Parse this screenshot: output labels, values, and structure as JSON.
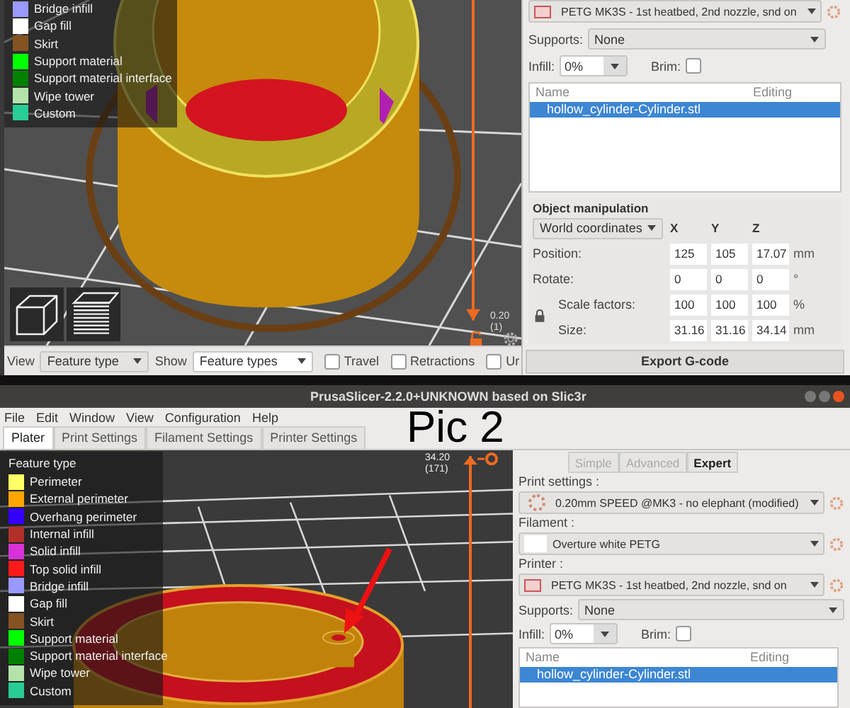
{
  "top": {
    "legend": [
      {
        "label": "Bridge infill",
        "color": "#9999ff"
      },
      {
        "label": "Gap fill",
        "color": "#ffffff"
      },
      {
        "label": "Skirt",
        "color": "#845321"
      },
      {
        "label": "Support material",
        "color": "#00ff00"
      },
      {
        "label": "Support material interface",
        "color": "#008000"
      },
      {
        "label": "Wipe tower",
        "color": "#b3e3ab"
      },
      {
        "label": "Custom",
        "color": "#28cc94"
      }
    ],
    "view": {
      "label": "View",
      "value": "Feature type"
    },
    "show": {
      "label": "Show",
      "value": "Feature types"
    },
    "options": [
      {
        "label": "Travel",
        "checked": false
      },
      {
        "label": "Retractions",
        "checked": false
      },
      {
        "label": "Ur",
        "checked": false
      }
    ],
    "slider": {
      "value": "0.20",
      "layer": "(1)"
    },
    "printer_value": "PETG MK3S - 1st heatbed, 2nd nozzle, snd on",
    "supports": {
      "label": "Supports:",
      "value": "None"
    },
    "infill": {
      "label": "Infill:",
      "value": "0%"
    },
    "brim": {
      "label": "Brim:",
      "checked": false
    },
    "list": {
      "columns": [
        "Name",
        "Editing"
      ],
      "rows": [
        {
          "name": "hollow_cylinder-Cylinder.stl",
          "selected": true
        }
      ]
    },
    "object_manipulation": {
      "title": "Object manipulation",
      "coordinates": "World coordinates",
      "axes": [
        "X",
        "Y",
        "Z"
      ],
      "rows": [
        {
          "label": "Position:",
          "values": [
            "125",
            "105",
            "17.07"
          ],
          "unit": "mm"
        },
        {
          "label": "Rotate:",
          "values": [
            "0",
            "0",
            "0"
          ],
          "unit": "°"
        },
        {
          "label": "Scale factors:",
          "values": [
            "100",
            "100",
            "100"
          ],
          "unit": "%"
        },
        {
          "label": "Size:",
          "values": [
            "31.16",
            "31.16",
            "34.14"
          ],
          "unit": "mm"
        }
      ]
    },
    "export_button": "Export G-code"
  },
  "bottom": {
    "title": "PrusaSlicer-2.2.0+UNKNOWN based on Slic3r",
    "annotation": "Pic 2",
    "menu": [
      "File",
      "Edit",
      "Window",
      "View",
      "Configuration",
      "Help"
    ],
    "tabs": [
      {
        "label": "Plater",
        "selected": true
      },
      {
        "label": "Print Settings",
        "selected": false
      },
      {
        "label": "Filament Settings",
        "selected": false
      },
      {
        "label": "Printer Settings",
        "selected": false
      }
    ],
    "legend": {
      "title": "Feature type",
      "items": [
        {
          "label": "Perimeter",
          "color": "#ffff66"
        },
        {
          "label": "External perimeter",
          "color": "#ffa500"
        },
        {
          "label": "Overhang perimeter",
          "color": "#3300ff"
        },
        {
          "label": "Internal infill",
          "color": "#b1302a"
        },
        {
          "label": "Solid infill",
          "color": "#d732d7"
        },
        {
          "label": "Top solid infill",
          "color": "#ff1a1a"
        },
        {
          "label": "Bridge infill",
          "color": "#9999ff"
        },
        {
          "label": "Gap fill",
          "color": "#ffffff"
        },
        {
          "label": "Skirt",
          "color": "#845321"
        },
        {
          "label": "Support material",
          "color": "#00ff00"
        },
        {
          "label": "Support material interface",
          "color": "#008000"
        },
        {
          "label": "Wipe tower",
          "color": "#b3e3ab"
        },
        {
          "label": "Custom",
          "color": "#28cc94"
        }
      ]
    },
    "slider": {
      "value": "34.20",
      "layer": "(171)"
    },
    "modes": [
      {
        "label": "Simple",
        "selected": false
      },
      {
        "label": "Advanced",
        "selected": false
      },
      {
        "label": "Expert",
        "selected": true
      }
    ],
    "presets": [
      {
        "kind": "print",
        "label": "Print settings :",
        "value": "0.20mm SPEED @MK3 - no elephant (modified)"
      },
      {
        "kind": "filament",
        "label": "Filament :",
        "value": "Overture white PETG"
      },
      {
        "kind": "printer",
        "label": "Printer :",
        "value": "PETG MK3S - 1st heatbed, 2nd nozzle, snd on"
      }
    ],
    "supports": {
      "label": "Supports:",
      "value": "None"
    },
    "infill": {
      "label": "Infill:",
      "value": "0%"
    },
    "brim": {
      "label": "Brim:",
      "checked": false
    },
    "list": {
      "columns": [
        "Name",
        "Editing"
      ],
      "rows": [
        {
          "name": "hollow_cylinder-Cylinder.stl",
          "selected": true
        }
      ]
    }
  }
}
